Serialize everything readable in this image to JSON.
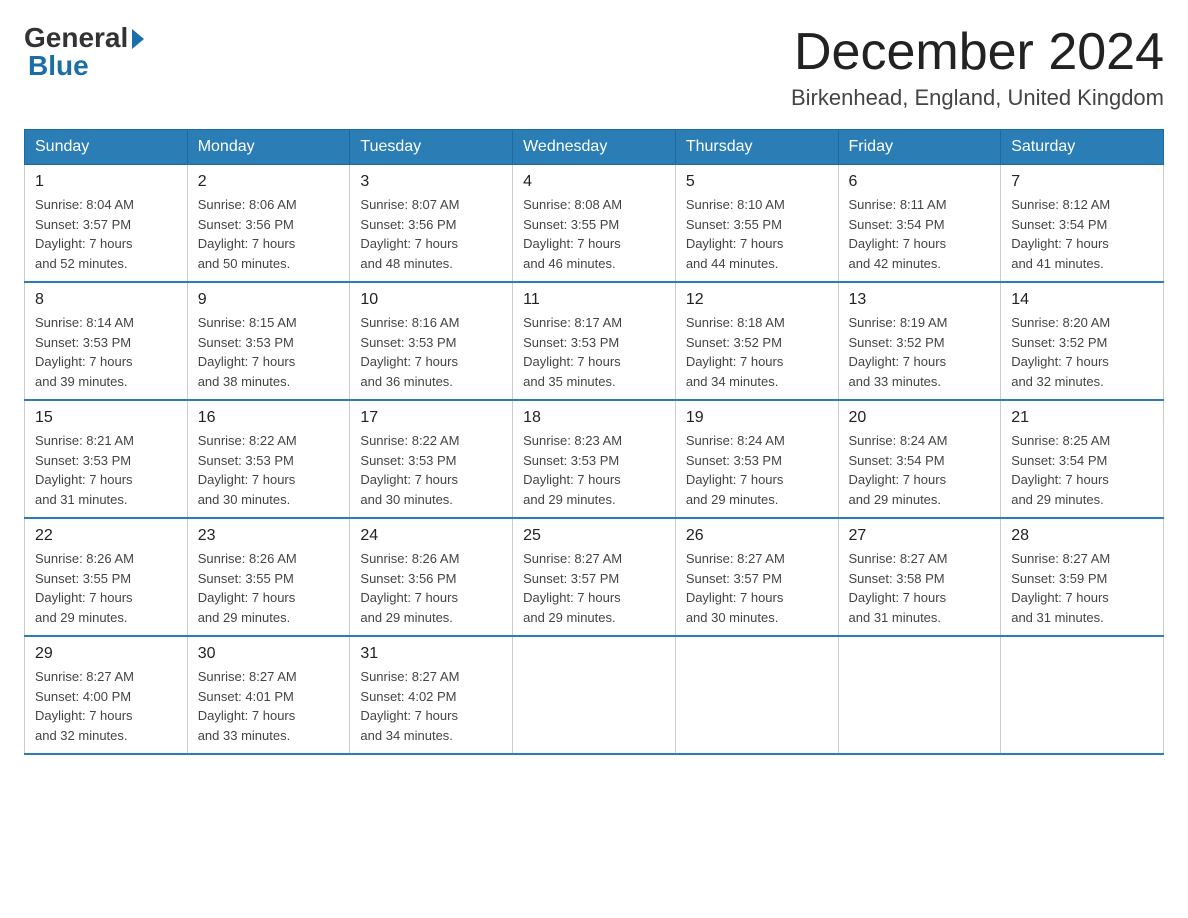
{
  "header": {
    "logo_general": "General",
    "logo_blue": "Blue",
    "month_title": "December 2024",
    "location": "Birkenhead, England, United Kingdom"
  },
  "days_of_week": [
    "Sunday",
    "Monday",
    "Tuesday",
    "Wednesday",
    "Thursday",
    "Friday",
    "Saturday"
  ],
  "weeks": [
    [
      {
        "day": "1",
        "sunrise": "Sunrise: 8:04 AM",
        "sunset": "Sunset: 3:57 PM",
        "daylight": "Daylight: 7 hours and 52 minutes."
      },
      {
        "day": "2",
        "sunrise": "Sunrise: 8:06 AM",
        "sunset": "Sunset: 3:56 PM",
        "daylight": "Daylight: 7 hours and 50 minutes."
      },
      {
        "day": "3",
        "sunrise": "Sunrise: 8:07 AM",
        "sunset": "Sunset: 3:56 PM",
        "daylight": "Daylight: 7 hours and 48 minutes."
      },
      {
        "day": "4",
        "sunrise": "Sunrise: 8:08 AM",
        "sunset": "Sunset: 3:55 PM",
        "daylight": "Daylight: 7 hours and 46 minutes."
      },
      {
        "day": "5",
        "sunrise": "Sunrise: 8:10 AM",
        "sunset": "Sunset: 3:55 PM",
        "daylight": "Daylight: 7 hours and 44 minutes."
      },
      {
        "day": "6",
        "sunrise": "Sunrise: 8:11 AM",
        "sunset": "Sunset: 3:54 PM",
        "daylight": "Daylight: 7 hours and 42 minutes."
      },
      {
        "day": "7",
        "sunrise": "Sunrise: 8:12 AM",
        "sunset": "Sunset: 3:54 PM",
        "daylight": "Daylight: 7 hours and 41 minutes."
      }
    ],
    [
      {
        "day": "8",
        "sunrise": "Sunrise: 8:14 AM",
        "sunset": "Sunset: 3:53 PM",
        "daylight": "Daylight: 7 hours and 39 minutes."
      },
      {
        "day": "9",
        "sunrise": "Sunrise: 8:15 AM",
        "sunset": "Sunset: 3:53 PM",
        "daylight": "Daylight: 7 hours and 38 minutes."
      },
      {
        "day": "10",
        "sunrise": "Sunrise: 8:16 AM",
        "sunset": "Sunset: 3:53 PM",
        "daylight": "Daylight: 7 hours and 36 minutes."
      },
      {
        "day": "11",
        "sunrise": "Sunrise: 8:17 AM",
        "sunset": "Sunset: 3:53 PM",
        "daylight": "Daylight: 7 hours and 35 minutes."
      },
      {
        "day": "12",
        "sunrise": "Sunrise: 8:18 AM",
        "sunset": "Sunset: 3:52 PM",
        "daylight": "Daylight: 7 hours and 34 minutes."
      },
      {
        "day": "13",
        "sunrise": "Sunrise: 8:19 AM",
        "sunset": "Sunset: 3:52 PM",
        "daylight": "Daylight: 7 hours and 33 minutes."
      },
      {
        "day": "14",
        "sunrise": "Sunrise: 8:20 AM",
        "sunset": "Sunset: 3:52 PM",
        "daylight": "Daylight: 7 hours and 32 minutes."
      }
    ],
    [
      {
        "day": "15",
        "sunrise": "Sunrise: 8:21 AM",
        "sunset": "Sunset: 3:53 PM",
        "daylight": "Daylight: 7 hours and 31 minutes."
      },
      {
        "day": "16",
        "sunrise": "Sunrise: 8:22 AM",
        "sunset": "Sunset: 3:53 PM",
        "daylight": "Daylight: 7 hours and 30 minutes."
      },
      {
        "day": "17",
        "sunrise": "Sunrise: 8:22 AM",
        "sunset": "Sunset: 3:53 PM",
        "daylight": "Daylight: 7 hours and 30 minutes."
      },
      {
        "day": "18",
        "sunrise": "Sunrise: 8:23 AM",
        "sunset": "Sunset: 3:53 PM",
        "daylight": "Daylight: 7 hours and 29 minutes."
      },
      {
        "day": "19",
        "sunrise": "Sunrise: 8:24 AM",
        "sunset": "Sunset: 3:53 PM",
        "daylight": "Daylight: 7 hours and 29 minutes."
      },
      {
        "day": "20",
        "sunrise": "Sunrise: 8:24 AM",
        "sunset": "Sunset: 3:54 PM",
        "daylight": "Daylight: 7 hours and 29 minutes."
      },
      {
        "day": "21",
        "sunrise": "Sunrise: 8:25 AM",
        "sunset": "Sunset: 3:54 PM",
        "daylight": "Daylight: 7 hours and 29 minutes."
      }
    ],
    [
      {
        "day": "22",
        "sunrise": "Sunrise: 8:26 AM",
        "sunset": "Sunset: 3:55 PM",
        "daylight": "Daylight: 7 hours and 29 minutes."
      },
      {
        "day": "23",
        "sunrise": "Sunrise: 8:26 AM",
        "sunset": "Sunset: 3:55 PM",
        "daylight": "Daylight: 7 hours and 29 minutes."
      },
      {
        "day": "24",
        "sunrise": "Sunrise: 8:26 AM",
        "sunset": "Sunset: 3:56 PM",
        "daylight": "Daylight: 7 hours and 29 minutes."
      },
      {
        "day": "25",
        "sunrise": "Sunrise: 8:27 AM",
        "sunset": "Sunset: 3:57 PM",
        "daylight": "Daylight: 7 hours and 29 minutes."
      },
      {
        "day": "26",
        "sunrise": "Sunrise: 8:27 AM",
        "sunset": "Sunset: 3:57 PM",
        "daylight": "Daylight: 7 hours and 30 minutes."
      },
      {
        "day": "27",
        "sunrise": "Sunrise: 8:27 AM",
        "sunset": "Sunset: 3:58 PM",
        "daylight": "Daylight: 7 hours and 31 minutes."
      },
      {
        "day": "28",
        "sunrise": "Sunrise: 8:27 AM",
        "sunset": "Sunset: 3:59 PM",
        "daylight": "Daylight: 7 hours and 31 minutes."
      }
    ],
    [
      {
        "day": "29",
        "sunrise": "Sunrise: 8:27 AM",
        "sunset": "Sunset: 4:00 PM",
        "daylight": "Daylight: 7 hours and 32 minutes."
      },
      {
        "day": "30",
        "sunrise": "Sunrise: 8:27 AM",
        "sunset": "Sunset: 4:01 PM",
        "daylight": "Daylight: 7 hours and 33 minutes."
      },
      {
        "day": "31",
        "sunrise": "Sunrise: 8:27 AM",
        "sunset": "Sunset: 4:02 PM",
        "daylight": "Daylight: 7 hours and 34 minutes."
      },
      null,
      null,
      null,
      null
    ]
  ]
}
